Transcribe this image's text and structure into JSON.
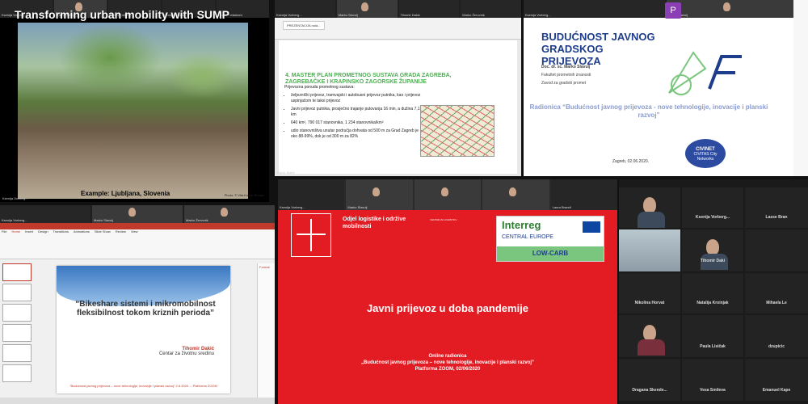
{
  "tile1": {
    "participants": [
      "Ksenija Vorberg...",
      "Marko Slavulj",
      "Vesna Smileva",
      "Mateja Kalavić",
      "Lasse Pietarinen"
    ],
    "title": "Transforming urban mobility with SUMP",
    "caption": "Example: Ljubljana, Slovenia",
    "credit": "Photo: © Vita Kocho Benjak",
    "speaker_label": "Ksenija Vorberg..."
  },
  "tile2": {
    "participants": [
      "Ksenija Vorberg...",
      "Marko Slavulj",
      "Tihomir Dakić",
      "Marko Žerovnik"
    ],
    "tab": "PREZENTACIJA nula...",
    "heading": "4. MASTER PLAN PROMETNOG SUSTAVA GRADA ZAGREBA, ZAGREBAČKE I KRAPINSKO ZAGORSKE ŽUPANIJE",
    "sub": "Prijevozna ponuda prometnog sustava:",
    "bullets": [
      "željeznički prijevoz, tramvajski i autobusni prijevoz putnika, kao i prijevoz uspinjačom te taksi prijevoz",
      "Javni prijevoz putnika, prosječno trajanje putovanja 16 min, a dužina 7,1 km",
      "640 km², 790 017 stanovnika, 1 234 stanovnika/km²",
      "udio stanovništva unutar područja dohvata od 500 m za Grad Zagreb je oko 88-99%, dok je od 300 m za 82%"
    ],
    "speaker_label": "Davor Babić"
  },
  "tile3": {
    "participants": [
      "Ksenija Vorberg...",
      "Marko Slavulj"
    ],
    "badge": "P",
    "title": "BUDUĆNOST JAVNOG GRADSKOG PRIJEVOZA",
    "author": "Doc. dr. sc. Marko Slavulj",
    "affil1": "Fakultet prometnih znanosti",
    "affil2": "Zavod za gradski promet",
    "workshop": "Radionica “Budućnost javnog prijevoza - nove tehnologije, inovacije i planski razvoj”",
    "date": "Zagreb, 02.06.2020.",
    "civinet": "CIVINET",
    "civinet_sub": "CIVITAS City Networks"
  },
  "tile4": {
    "participants": [
      "Ksenija Vorberg...",
      "Marko Slavulj",
      "Marko Žerovnik"
    ],
    "menu": [
      "File",
      "Home",
      "Insert",
      "Design",
      "Transitions",
      "Animations",
      "Slide Show",
      "Review",
      "View"
    ],
    "slide_title": "“Bikeshare sistemi i mikromobilnost fleksibilnost tokom kriznih perioda”",
    "presenter": "Tihomir Dakić",
    "presenter_org": "Centar za životnu sredinu",
    "footer": "“Budućnost javnog prijevoza – nove tehnologije, inovacije i planski razvoj” 2.6.2020. – Platforma ZOOM",
    "panel_label": "Format"
  },
  "tile5": {
    "participants": [
      "Ksenija Vorberg...",
      "Marko Slavulj",
      "Laura Brandt"
    ],
    "dept": "Odjel logistike i održive mobilnosti",
    "center_text": "CENTAR ZA LOGISTIKU",
    "interreg": "Interreg",
    "central_europe": "CENTRAL EUROPE",
    "low_carb": "LOW-CARB",
    "title": "Javni prijevoz u doba pandemije",
    "footer_lines": [
      "Online radionica",
      "„Budućnost javnog prijevoza – nove tehnologije, inovacije i planski razvoj”",
      "Platforma ZOOM, 02/06/2020"
    ]
  },
  "tile6": {
    "grid": [
      [
        "",
        "Ksenija Vorberg...",
        "Lasse Bran"
      ],
      [
        "",
        "Tihomir Daki",
        ""
      ],
      [
        "Nikolina Horvat",
        "Natalija Kroinjak",
        "Mihaela Le"
      ],
      [
        "",
        "Paula Lisičak",
        "dzupicic"
      ],
      [
        "Dragana Skende...",
        "Vesa Smileva",
        "Emanuel Kape"
      ]
    ]
  }
}
